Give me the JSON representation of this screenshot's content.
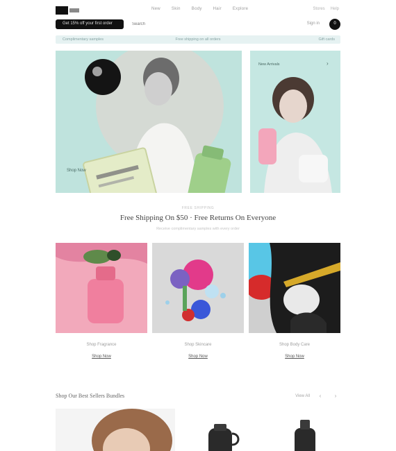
{
  "brand": {
    "logo_alt": "logo"
  },
  "topnav": {
    "items": [
      "New",
      "Skin",
      "Body",
      "Hair",
      "Explore"
    ]
  },
  "toplinks": {
    "items": [
      "Stores",
      "Help"
    ]
  },
  "promo": {
    "label": "Get 15% off your first order"
  },
  "search": {
    "placeholder": "Search"
  },
  "account": {
    "signin_label": "Sign in"
  },
  "cart": {
    "count": "0"
  },
  "announcement": {
    "left": "Complimentary samples",
    "center": "Free shipping on all orders",
    "right": "Gift cards"
  },
  "hero": {
    "main_caption": "Shop Now",
    "side_caption": "New Arrivals"
  },
  "shipping": {
    "kicker": "FREE SHIPPING",
    "title": "Free Shipping On $50 · Free Returns On Everyone",
    "subtitle": "Receive complimentary samples with every order"
  },
  "categories": [
    {
      "label": "Shop Fragrance",
      "link": "Shop Now"
    },
    {
      "label": "Shop Skincare",
      "link": "Shop Now"
    },
    {
      "label": "Shop Body Care",
      "link": "Shop Now"
    }
  ],
  "bestsellers": {
    "title": "Shop Our Best Sellers Bundles",
    "view_all": "View All",
    "prev": "‹",
    "next": "›"
  },
  "colors": {
    "hero_bg": "#bfe3dd",
    "announce_bg": "#e6f2f2",
    "cat1_bg": "#f2a9bb",
    "cat2_bg": "#d9d9d9",
    "cat3_bg": "#cfcfcf"
  }
}
